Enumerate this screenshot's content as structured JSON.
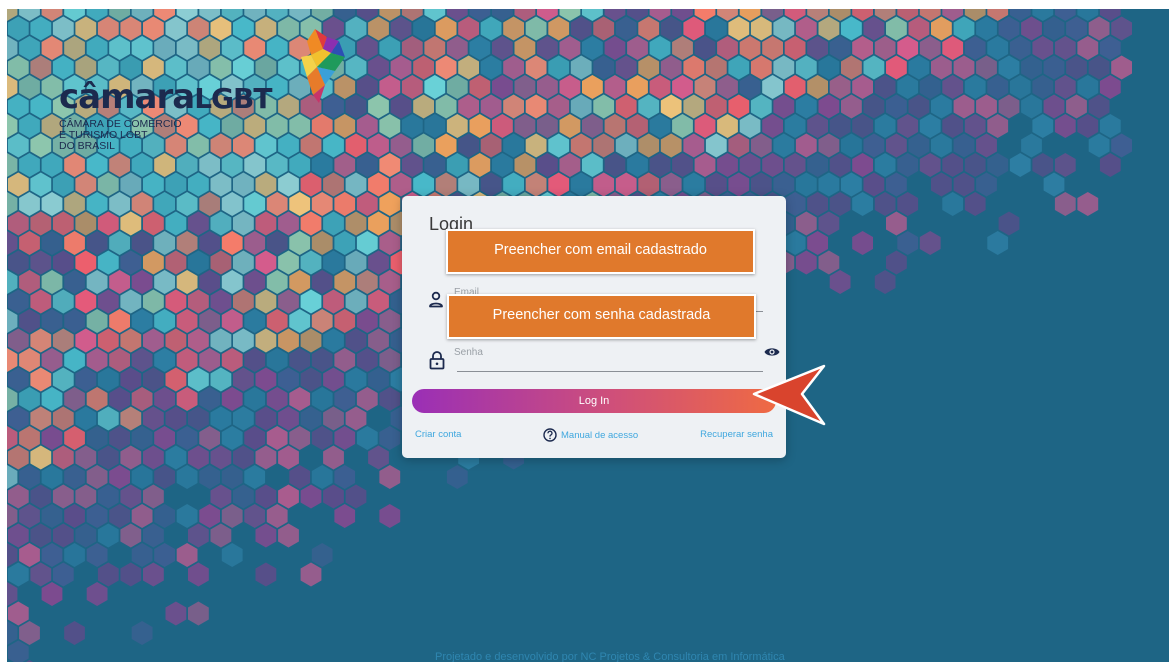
{
  "brand": {
    "name_bold": "câmara",
    "name_light": "LGBT",
    "tagline_lines": [
      "CÂMARA DE COMÉRCIO",
      "E TURISMO LGBT",
      "DO BRASIL"
    ]
  },
  "login": {
    "title": "Login",
    "email_placeholder": "Email",
    "password_placeholder": "Senha",
    "login_button": "Log In",
    "create_account": "Criar conta",
    "manual": "Manual de acesso",
    "recover_password": "Recuperar senha"
  },
  "annotations": {
    "email_hint": "Preencher com email cadastrado",
    "password_hint": "Preencher com senha cadastrada"
  },
  "footer": {
    "text": "Projetado e desenvolvido por NC Projetos & Consultoria em Informática"
  },
  "colors": {
    "background": "#1e6585",
    "card": "#eef1f4",
    "annotation": "#e0792c",
    "arrow": "#d9442d",
    "link": "#3fa7de",
    "button_gradient": [
      "#9a2fb6",
      "#ef6a43"
    ]
  },
  "icons": {
    "user": "user-icon",
    "lock": "lock-icon",
    "eye": "eye-icon",
    "help": "help-circle-icon"
  }
}
